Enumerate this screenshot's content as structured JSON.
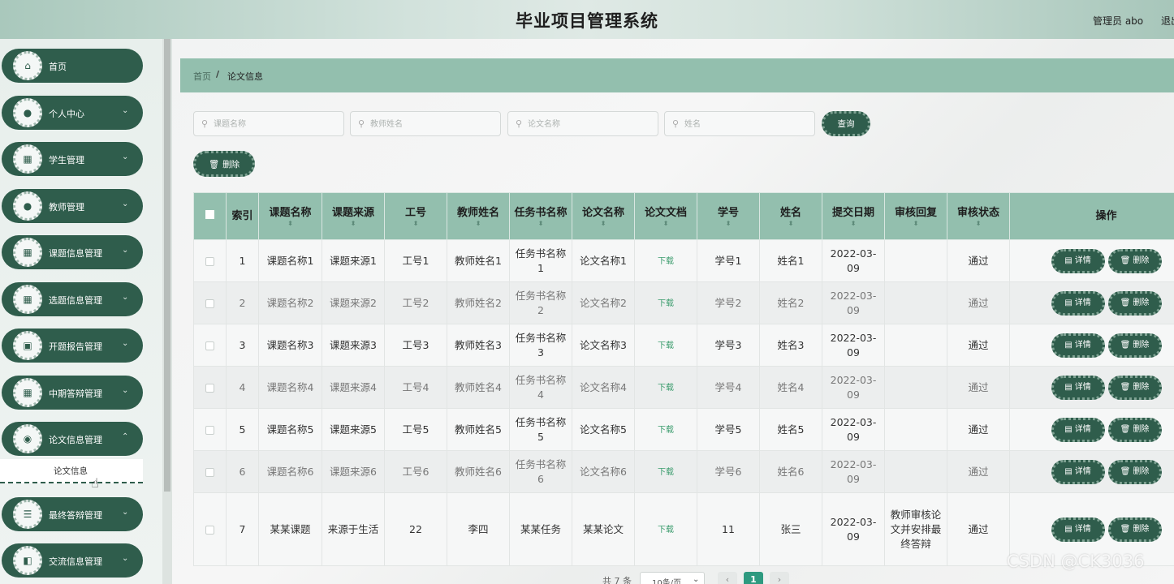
{
  "header": {
    "title": "毕业项目管理系统",
    "user": "管理员 abo",
    "logout": "退出"
  },
  "sidebar": {
    "items": [
      {
        "label": "首页",
        "icon": "home-icon",
        "glyph": "⌂",
        "chevron": ""
      },
      {
        "label": "个人中心",
        "icon": "user-icon",
        "glyph": "●",
        "chevron": "⌄"
      },
      {
        "label": "学生管理",
        "icon": "grid-icon",
        "glyph": "▦",
        "chevron": "⌄"
      },
      {
        "label": "教师管理",
        "icon": "user-icon",
        "glyph": "●",
        "chevron": "⌄"
      },
      {
        "label": "课题信息管理",
        "icon": "grid-icon",
        "glyph": "▦",
        "chevron": "⌄"
      },
      {
        "label": "选题信息管理",
        "icon": "grid-icon",
        "glyph": "▦",
        "chevron": "⌄"
      },
      {
        "label": "开题报告管理",
        "icon": "chart-icon",
        "glyph": "▣",
        "chevron": "⌄"
      },
      {
        "label": "中期答辩管理",
        "icon": "grid-icon",
        "glyph": "▦",
        "chevron": "⌄"
      },
      {
        "label": "论文信息管理",
        "icon": "pin-icon",
        "glyph": "◉",
        "chevron": "⌃"
      },
      {
        "label": "最终答辩管理",
        "icon": "sliders-icon",
        "glyph": "☰",
        "chevron": "⌄"
      },
      {
        "label": "交流信息管理",
        "icon": "briefcase-icon",
        "glyph": "◧",
        "chevron": "⌄"
      }
    ],
    "submenu": {
      "label": "论文信息"
    }
  },
  "breadcrumb": {
    "home": "首页",
    "sep": "/",
    "current": "论文信息"
  },
  "search": {
    "fields": [
      {
        "name": "topic-name-search-input",
        "placeholder": "课题名称"
      },
      {
        "name": "teacher-name-search-input",
        "placeholder": "教师姓名"
      },
      {
        "name": "paper-name-search-input",
        "placeholder": "论文名称"
      },
      {
        "name": "student-name-search-input",
        "placeholder": "姓名"
      }
    ],
    "query_label": "查询"
  },
  "toolbar": {
    "delete_label": "删除",
    "delete_icon": "trash-icon"
  },
  "table": {
    "headers": [
      "索引",
      "课题名称",
      "课题来源",
      "工号",
      "教师姓名",
      "任务书名称",
      "论文名称",
      "论文文档",
      "学号",
      "姓名",
      "提交日期",
      "审核回复",
      "审核状态",
      "操作"
    ],
    "rows": [
      {
        "index": "1",
        "topic": "课题名称1",
        "source": "课题来源1",
        "job_no": "工号1",
        "teacher": "教师姓名1",
        "task": "任务书名称1",
        "paper": "论文名称1",
        "doc": "下载",
        "student_no": "学号1",
        "name": "姓名1",
        "date": "2022-03-09",
        "reply": "",
        "status": "通过"
      },
      {
        "index": "2",
        "topic": "课题名称2",
        "source": "课题来源2",
        "job_no": "工号2",
        "teacher": "教师姓名2",
        "task": "任务书名称2",
        "paper": "论文名称2",
        "doc": "下载",
        "student_no": "学号2",
        "name": "姓名2",
        "date": "2022-03-09",
        "reply": "",
        "status": "通过"
      },
      {
        "index": "3",
        "topic": "课题名称3",
        "source": "课题来源3",
        "job_no": "工号3",
        "teacher": "教师姓名3",
        "task": "任务书名称3",
        "paper": "论文名称3",
        "doc": "下载",
        "student_no": "学号3",
        "name": "姓名3",
        "date": "2022-03-09",
        "reply": "",
        "status": "通过"
      },
      {
        "index": "4",
        "topic": "课题名称4",
        "source": "课题来源4",
        "job_no": "工号4",
        "teacher": "教师姓名4",
        "task": "任务书名称4",
        "paper": "论文名称4",
        "doc": "下载",
        "student_no": "学号4",
        "name": "姓名4",
        "date": "2022-03-09",
        "reply": "",
        "status": "通过"
      },
      {
        "index": "5",
        "topic": "课题名称5",
        "source": "课题来源5",
        "job_no": "工号5",
        "teacher": "教师姓名5",
        "task": "任务书名称5",
        "paper": "论文名称5",
        "doc": "下载",
        "student_no": "学号5",
        "name": "姓名5",
        "date": "2022-03-09",
        "reply": "",
        "status": "通过"
      },
      {
        "index": "6",
        "topic": "课题名称6",
        "source": "课题来源6",
        "job_no": "工号6",
        "teacher": "教师姓名6",
        "task": "任务书名称6",
        "paper": "论文名称6",
        "doc": "下载",
        "student_no": "学号6",
        "name": "姓名6",
        "date": "2022-03-09",
        "reply": "",
        "status": "通过"
      },
      {
        "index": "7",
        "topic": "某某课题",
        "source": "来源于生活",
        "job_no": "22",
        "teacher": "李四",
        "task": "某某任务",
        "paper": "某某论文",
        "doc": "下载",
        "student_no": "11",
        "name": "张三",
        "date": "2022-03-09",
        "reply": "教师审核论文并安排最终答辩",
        "status": "通过"
      }
    ],
    "detail_label": "详情",
    "delete_label": "删除"
  },
  "pager": {
    "total": "共 7 条",
    "size": "10条/页",
    "prev": "‹",
    "current": "1",
    "next": "›"
  },
  "watermark": "CSDN @CK3036"
}
